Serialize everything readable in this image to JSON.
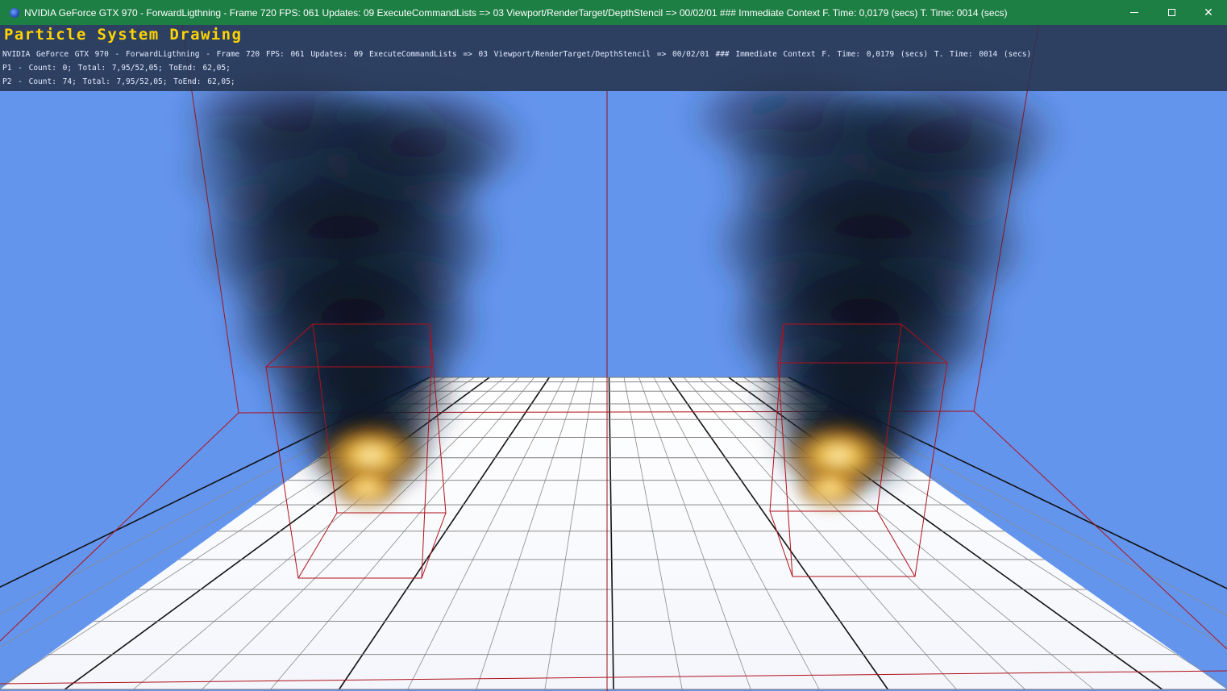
{
  "window": {
    "title": "NVIDIA GeForce GTX 970 - ForwardLigthning - Frame 720 FPS: 061 Updates: 09 ExecuteCommandLists => 03 Viewport/RenderTarget/DepthStencil => 00/02/01 ### Immediate Context F. Time: 0,0179 (secs) T. Time: 0014 (secs)",
    "icon": "app-icon",
    "controls": {
      "minimize_icon": "minimize-icon",
      "maximize_icon": "maximize-icon",
      "close_icon": "close-icon",
      "close_glyph": "✕"
    }
  },
  "hud": {
    "title": "Particle System Drawing",
    "stats_line": "NVIDIA GeForce GTX 970 - ForwardLigthning - Frame 720 FPS: 061 Updates: 09 ExecuteCommandLists => 03 Viewport/RenderTarget/DepthStencil => 00/02/01 ### Immediate Context F. Time: 0,0179 (secs) T. Time: 0014 (secs)",
    "particle_systems": [
      {
        "label": "P1 - Count: 0; Total: 7,95/52,05; ToEnd: 62,05;"
      },
      {
        "label": "P2 - Count: 74; Total: 7,95/52,05; ToEnd: 62,05;"
      }
    ]
  },
  "colors": {
    "titlebar": "#1e7f45",
    "sky": "#6495ED",
    "hud_title": "#ffd400",
    "hud_text": "#e6ecff",
    "bounding_box": "#b0101a",
    "floor": "#ffffff",
    "grid_major": "#000000",
    "smoke": "#0b1320",
    "fire": "#f0a020"
  }
}
